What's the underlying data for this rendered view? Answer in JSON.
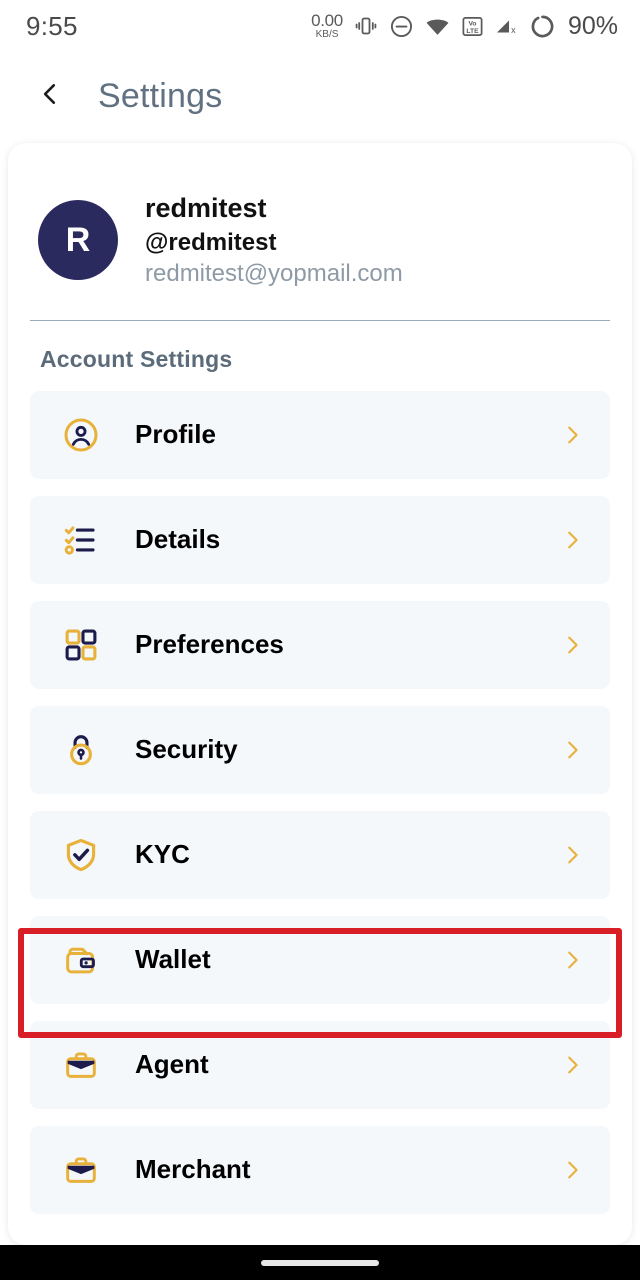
{
  "statusbar": {
    "time": "9:55",
    "network_speed_value": "0.00",
    "network_speed_unit": "KB/S",
    "icons": [
      "vibrate-icon",
      "do-not-disturb-icon",
      "wifi-icon",
      "volte-icon",
      "cellular-off-icon",
      "battery-ring-icon"
    ],
    "battery": "90%"
  },
  "header": {
    "back_icon": "chevron-left-icon",
    "title": "Settings"
  },
  "profile": {
    "avatar_initial": "R",
    "name": "redmitest",
    "handle": "@redmitest",
    "email": "redmitest@yopmail.com"
  },
  "section": {
    "title": "Account Settings"
  },
  "rows": [
    {
      "label": "Profile",
      "icon": "user-circle-icon"
    },
    {
      "label": "Details",
      "icon": "checklist-icon"
    },
    {
      "label": "Preferences",
      "icon": "grid-squares-icon"
    },
    {
      "label": "Security",
      "icon": "padlock-icon"
    },
    {
      "label": "KYC",
      "icon": "shield-check-icon"
    },
    {
      "label": "Wallet",
      "icon": "wallet-icon"
    },
    {
      "label": "Agent",
      "icon": "briefcase-icon"
    },
    {
      "label": "Merchant",
      "icon": "briefcase-icon"
    }
  ],
  "annotation": {
    "target": "Wallet",
    "color": "#d81f26"
  },
  "colors": {
    "accent_gold": "#e8b13a",
    "navy": "#2b2a5e",
    "row_bg": "#f4f8fb",
    "title_gray": "#607181"
  }
}
